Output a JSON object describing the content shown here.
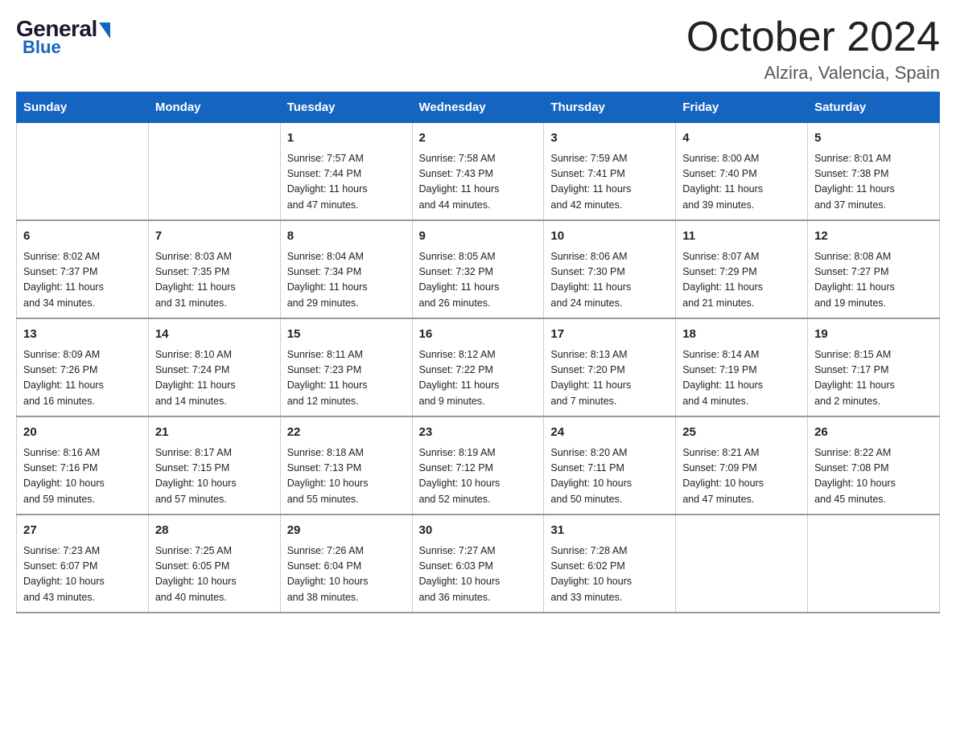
{
  "header": {
    "logo_general": "General",
    "logo_blue": "Blue",
    "month_title": "October 2024",
    "location": "Alzira, Valencia, Spain"
  },
  "weekdays": [
    "Sunday",
    "Monday",
    "Tuesday",
    "Wednesday",
    "Thursday",
    "Friday",
    "Saturday"
  ],
  "weeks": [
    [
      {
        "day": "",
        "info": ""
      },
      {
        "day": "",
        "info": ""
      },
      {
        "day": "1",
        "info": "Sunrise: 7:57 AM\nSunset: 7:44 PM\nDaylight: 11 hours\nand 47 minutes."
      },
      {
        "day": "2",
        "info": "Sunrise: 7:58 AM\nSunset: 7:43 PM\nDaylight: 11 hours\nand 44 minutes."
      },
      {
        "day": "3",
        "info": "Sunrise: 7:59 AM\nSunset: 7:41 PM\nDaylight: 11 hours\nand 42 minutes."
      },
      {
        "day": "4",
        "info": "Sunrise: 8:00 AM\nSunset: 7:40 PM\nDaylight: 11 hours\nand 39 minutes."
      },
      {
        "day": "5",
        "info": "Sunrise: 8:01 AM\nSunset: 7:38 PM\nDaylight: 11 hours\nand 37 minutes."
      }
    ],
    [
      {
        "day": "6",
        "info": "Sunrise: 8:02 AM\nSunset: 7:37 PM\nDaylight: 11 hours\nand 34 minutes."
      },
      {
        "day": "7",
        "info": "Sunrise: 8:03 AM\nSunset: 7:35 PM\nDaylight: 11 hours\nand 31 minutes."
      },
      {
        "day": "8",
        "info": "Sunrise: 8:04 AM\nSunset: 7:34 PM\nDaylight: 11 hours\nand 29 minutes."
      },
      {
        "day": "9",
        "info": "Sunrise: 8:05 AM\nSunset: 7:32 PM\nDaylight: 11 hours\nand 26 minutes."
      },
      {
        "day": "10",
        "info": "Sunrise: 8:06 AM\nSunset: 7:30 PM\nDaylight: 11 hours\nand 24 minutes."
      },
      {
        "day": "11",
        "info": "Sunrise: 8:07 AM\nSunset: 7:29 PM\nDaylight: 11 hours\nand 21 minutes."
      },
      {
        "day": "12",
        "info": "Sunrise: 8:08 AM\nSunset: 7:27 PM\nDaylight: 11 hours\nand 19 minutes."
      }
    ],
    [
      {
        "day": "13",
        "info": "Sunrise: 8:09 AM\nSunset: 7:26 PM\nDaylight: 11 hours\nand 16 minutes."
      },
      {
        "day": "14",
        "info": "Sunrise: 8:10 AM\nSunset: 7:24 PM\nDaylight: 11 hours\nand 14 minutes."
      },
      {
        "day": "15",
        "info": "Sunrise: 8:11 AM\nSunset: 7:23 PM\nDaylight: 11 hours\nand 12 minutes."
      },
      {
        "day": "16",
        "info": "Sunrise: 8:12 AM\nSunset: 7:22 PM\nDaylight: 11 hours\nand 9 minutes."
      },
      {
        "day": "17",
        "info": "Sunrise: 8:13 AM\nSunset: 7:20 PM\nDaylight: 11 hours\nand 7 minutes."
      },
      {
        "day": "18",
        "info": "Sunrise: 8:14 AM\nSunset: 7:19 PM\nDaylight: 11 hours\nand 4 minutes."
      },
      {
        "day": "19",
        "info": "Sunrise: 8:15 AM\nSunset: 7:17 PM\nDaylight: 11 hours\nand 2 minutes."
      }
    ],
    [
      {
        "day": "20",
        "info": "Sunrise: 8:16 AM\nSunset: 7:16 PM\nDaylight: 10 hours\nand 59 minutes."
      },
      {
        "day": "21",
        "info": "Sunrise: 8:17 AM\nSunset: 7:15 PM\nDaylight: 10 hours\nand 57 minutes."
      },
      {
        "day": "22",
        "info": "Sunrise: 8:18 AM\nSunset: 7:13 PM\nDaylight: 10 hours\nand 55 minutes."
      },
      {
        "day": "23",
        "info": "Sunrise: 8:19 AM\nSunset: 7:12 PM\nDaylight: 10 hours\nand 52 minutes."
      },
      {
        "day": "24",
        "info": "Sunrise: 8:20 AM\nSunset: 7:11 PM\nDaylight: 10 hours\nand 50 minutes."
      },
      {
        "day": "25",
        "info": "Sunrise: 8:21 AM\nSunset: 7:09 PM\nDaylight: 10 hours\nand 47 minutes."
      },
      {
        "day": "26",
        "info": "Sunrise: 8:22 AM\nSunset: 7:08 PM\nDaylight: 10 hours\nand 45 minutes."
      }
    ],
    [
      {
        "day": "27",
        "info": "Sunrise: 7:23 AM\nSunset: 6:07 PM\nDaylight: 10 hours\nand 43 minutes."
      },
      {
        "day": "28",
        "info": "Sunrise: 7:25 AM\nSunset: 6:05 PM\nDaylight: 10 hours\nand 40 minutes."
      },
      {
        "day": "29",
        "info": "Sunrise: 7:26 AM\nSunset: 6:04 PM\nDaylight: 10 hours\nand 38 minutes."
      },
      {
        "day": "30",
        "info": "Sunrise: 7:27 AM\nSunset: 6:03 PM\nDaylight: 10 hours\nand 36 minutes."
      },
      {
        "day": "31",
        "info": "Sunrise: 7:28 AM\nSunset: 6:02 PM\nDaylight: 10 hours\nand 33 minutes."
      },
      {
        "day": "",
        "info": ""
      },
      {
        "day": "",
        "info": ""
      }
    ]
  ]
}
